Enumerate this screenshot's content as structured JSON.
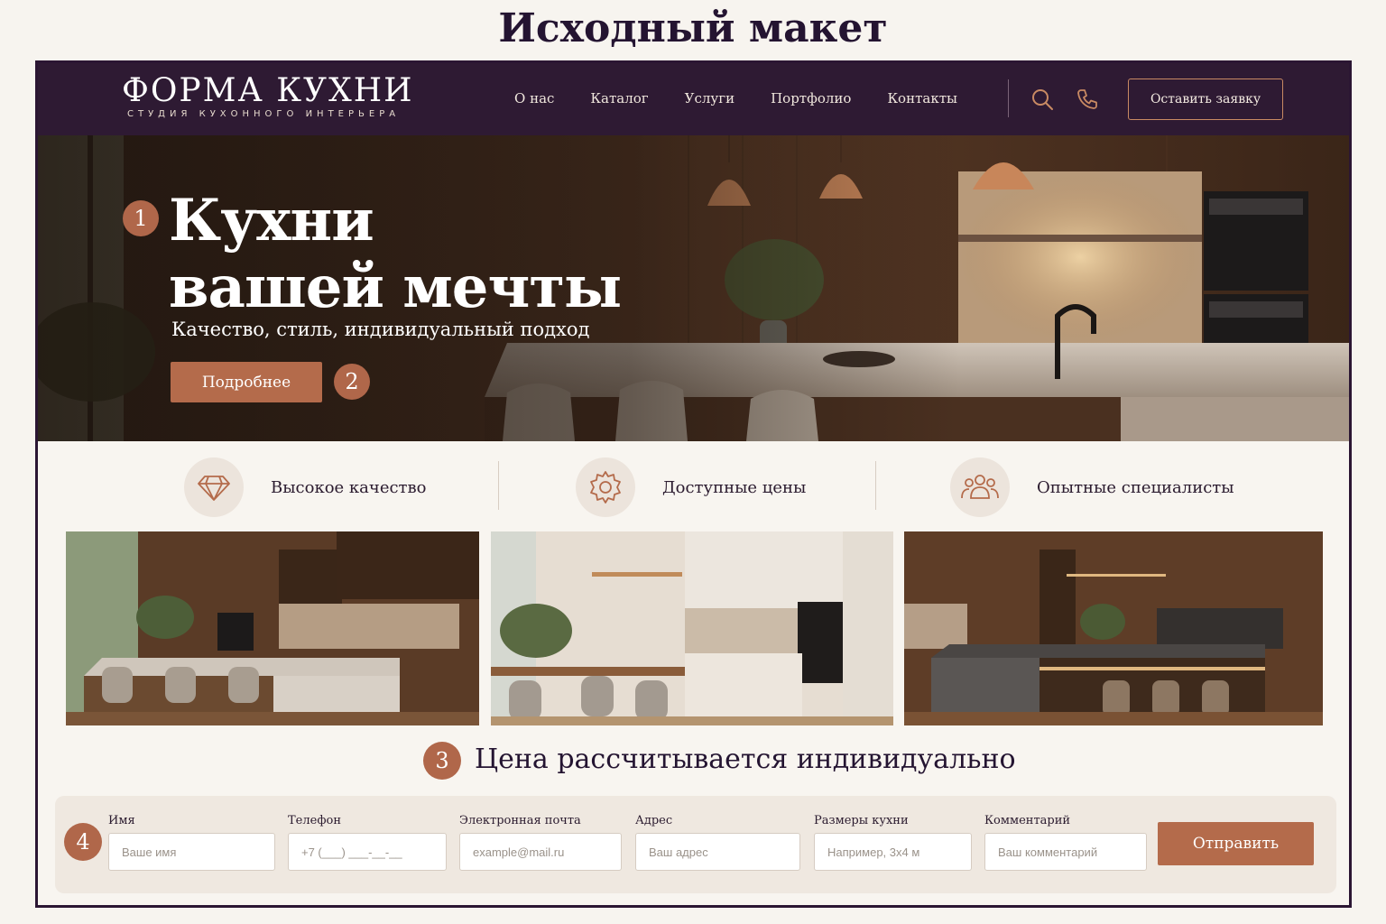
{
  "page_caption": "Исходный макет",
  "header": {
    "logo_name": "ФОРМА КУХНИ",
    "logo_sub": "СТУДИЯ КУХОННОГО ИНТЕРЬЕРА",
    "nav": [
      "О нас",
      "Каталог",
      "Услуги",
      "Портфолио",
      "Контакты"
    ],
    "search_icon": "search-icon",
    "phone_icon": "phone-icon",
    "cta_label": "Оставить заявку"
  },
  "hero": {
    "badge": "1",
    "title_line1": "Кухни",
    "title_line2": "вашей мечты",
    "subtitle": "Качество, стиль, индивидуальный подход",
    "button_label": "Подробнее",
    "button_badge": "2"
  },
  "features": [
    {
      "icon": "diamond-icon",
      "label": "Высокое качество"
    },
    {
      "icon": "gear-icon",
      "label": "Доступные цены"
    },
    {
      "icon": "people-icon",
      "label": "Опытные специалисты"
    }
  ],
  "price": {
    "badge": "3",
    "text": "Цена рассчитывается индивидуально"
  },
  "form": {
    "badge": "4",
    "fields": [
      {
        "label": "Имя",
        "placeholder": "Ваше имя"
      },
      {
        "label": "Телефон",
        "placeholder": "+7 (___) ___-__-__"
      },
      {
        "label": "Электронная почта",
        "placeholder": "example@mail.ru"
      },
      {
        "label": "Адрес",
        "placeholder": "Ваш адрес"
      },
      {
        "label": "Размеры кухни",
        "placeholder": "Например, 3х4 м"
      },
      {
        "label": "Комментарий",
        "placeholder": "Ваш комментарий"
      }
    ],
    "submit_label": "Отправить"
  },
  "colors": {
    "header_bg": "#2e1a33",
    "accent": "#b46b4b",
    "page_bg": "#f8f5f0"
  }
}
